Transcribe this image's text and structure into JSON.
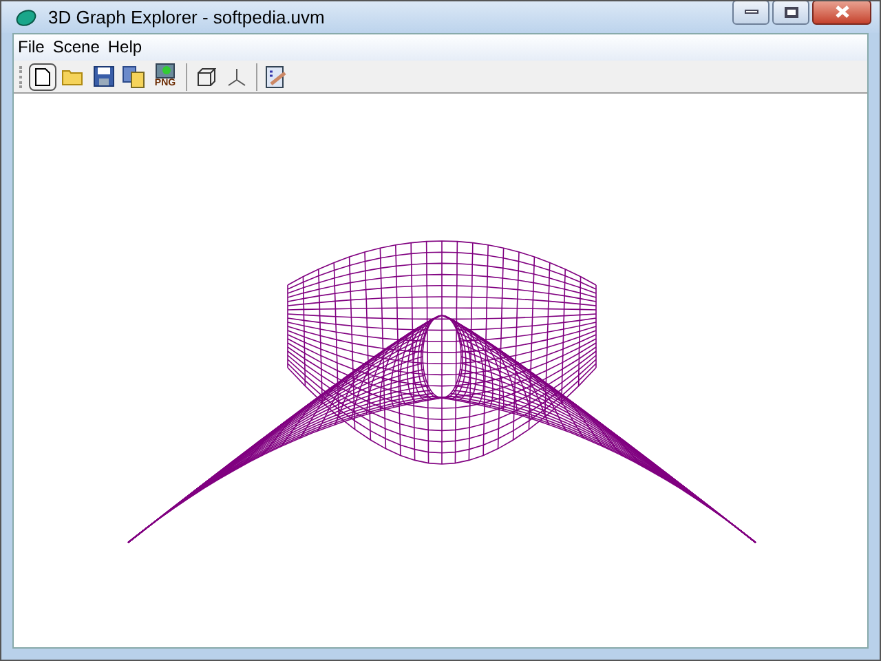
{
  "window": {
    "title": "3D Graph Explorer - softpedia.uvm"
  },
  "menu": [
    "File",
    "Scene",
    "Help"
  ],
  "toolbar": [
    {
      "kind": "new"
    },
    {
      "kind": "open"
    },
    {
      "kind": "save"
    },
    {
      "kind": "copy"
    },
    {
      "kind": "png",
      "badge": "PNG"
    },
    {
      "kind": "separator"
    },
    {
      "kind": "cube"
    },
    {
      "kind": "axes"
    },
    {
      "kind": "separator"
    },
    {
      "kind": "edit"
    }
  ]
}
